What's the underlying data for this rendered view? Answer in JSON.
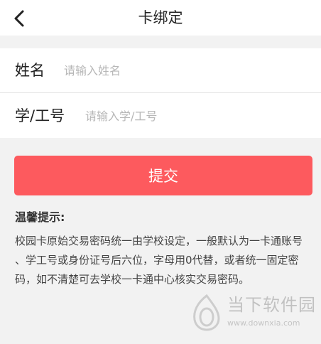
{
  "header": {
    "title": "卡绑定",
    "back_icon": "chevron-left-icon"
  },
  "form": {
    "name_label": "姓名",
    "name_placeholder": "请输入姓名",
    "name_value": "",
    "id_label": "学/工号",
    "id_placeholder": "请输入学/工号",
    "id_value": ""
  },
  "submit": {
    "label": "提交"
  },
  "notice": {
    "title": "温馨提示:",
    "body": "校园卡原始交易密码统一由学校设定，一般默认为一卡通账号 、学工号或身份证号后六位，字母用0代替，或者统一固定密码，如不清楚可去学校一卡通中心核实交易密码。"
  },
  "watermark": {
    "brand": "当下软件园",
    "url": "www.downxia.com"
  },
  "colors": {
    "primary": "#fd5a5e",
    "background": "#f2f2f2",
    "card": "#ffffff",
    "placeholder": "#b7b7b7"
  }
}
